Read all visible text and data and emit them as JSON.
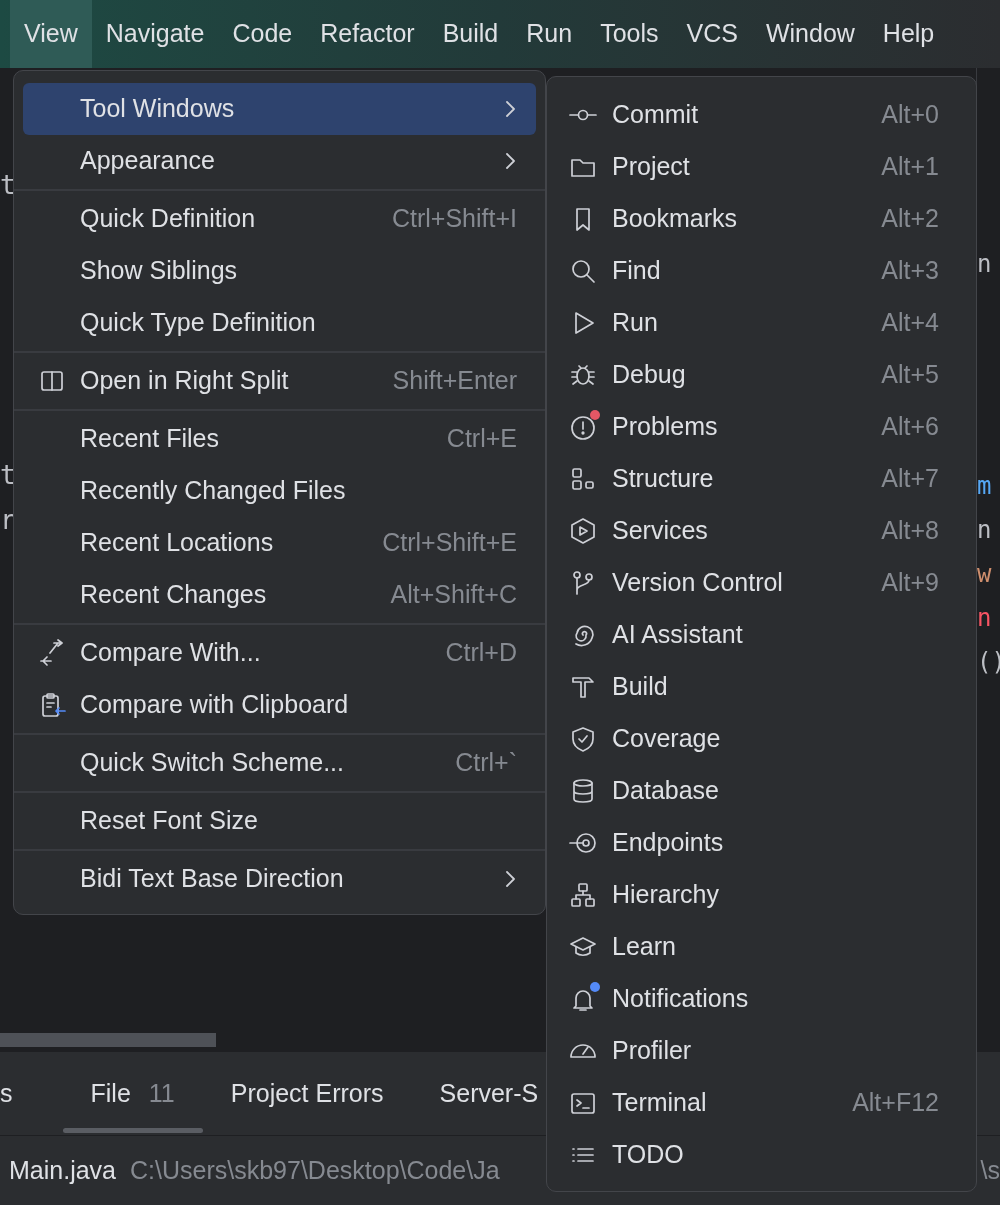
{
  "menu_bar": [
    {
      "label": "View",
      "selected": true
    },
    {
      "label": "Navigate",
      "selected": false
    },
    {
      "label": "Code",
      "selected": false
    },
    {
      "label": "Refactor",
      "selected": false
    },
    {
      "label": "Build",
      "selected": false
    },
    {
      "label": "Run",
      "selected": false
    },
    {
      "label": "Tools",
      "selected": false
    },
    {
      "label": "VCS",
      "selected": false
    },
    {
      "label": "Window",
      "selected": false
    },
    {
      "label": "Help",
      "selected": false
    }
  ],
  "view_menu": [
    {
      "kind": "item",
      "label": "Tool Windows",
      "has_submenu": true,
      "selected": true
    },
    {
      "kind": "item",
      "label": "Appearance",
      "has_submenu": true,
      "selected": false
    },
    {
      "kind": "separator"
    },
    {
      "kind": "item",
      "label": "Quick Definition",
      "shortcut": "Ctrl+Shift+I",
      "has_submenu": false,
      "selected": false
    },
    {
      "kind": "item",
      "label": "Show Siblings",
      "has_submenu": false,
      "selected": false
    },
    {
      "kind": "item",
      "label": "Quick Type Definition",
      "has_submenu": false,
      "selected": false
    },
    {
      "kind": "separator"
    },
    {
      "kind": "item",
      "label": "Open in Right Split",
      "shortcut": "Shift+Enter",
      "has_submenu": false,
      "selected": false
    },
    {
      "kind": "separator"
    },
    {
      "kind": "item",
      "label": "Recent Files",
      "shortcut": "Ctrl+E",
      "has_submenu": false,
      "selected": false
    },
    {
      "kind": "item",
      "label": "Recently Changed Files",
      "has_submenu": false,
      "selected": false
    },
    {
      "kind": "item",
      "label": "Recent Locations",
      "shortcut": "Ctrl+Shift+E",
      "has_submenu": false,
      "selected": false
    },
    {
      "kind": "item",
      "label": "Recent Changes",
      "shortcut": "Alt+Shift+C",
      "has_submenu": false,
      "selected": false
    },
    {
      "kind": "separator"
    },
    {
      "kind": "item",
      "label": "Compare With...",
      "shortcut": "Ctrl+D",
      "has_submenu": false,
      "selected": false
    },
    {
      "kind": "item",
      "label": "Compare with Clipboard",
      "has_submenu": false,
      "selected": false
    },
    {
      "kind": "separator"
    },
    {
      "kind": "item",
      "label": "Quick Switch Scheme...",
      "shortcut": "Ctrl+`",
      "has_submenu": false,
      "selected": false
    },
    {
      "kind": "separator"
    },
    {
      "kind": "item",
      "label": "Reset Font Size",
      "has_submenu": false,
      "selected": false
    },
    {
      "kind": "separator"
    },
    {
      "kind": "item",
      "label": "Bidi Text Base Direction",
      "has_submenu": true,
      "selected": false
    }
  ],
  "tool_windows": [
    {
      "label": "Commit",
      "shortcut": "Alt+0"
    },
    {
      "label": "Project",
      "shortcut": "Alt+1"
    },
    {
      "label": "Bookmarks",
      "shortcut": "Alt+2"
    },
    {
      "label": "Find",
      "shortcut": "Alt+3"
    },
    {
      "label": "Run",
      "shortcut": "Alt+4"
    },
    {
      "label": "Debug",
      "shortcut": "Alt+5"
    },
    {
      "label": "Problems",
      "shortcut": "Alt+6",
      "color": "#e55765"
    },
    {
      "label": "Structure",
      "shortcut": "Alt+7"
    },
    {
      "label": "Services",
      "shortcut": "Alt+8"
    },
    {
      "label": "Version Control",
      "shortcut": "Alt+9"
    },
    {
      "label": "AI Assistant"
    },
    {
      "label": "Build"
    },
    {
      "label": "Coverage"
    },
    {
      "label": "Database"
    },
    {
      "label": "Endpoints"
    },
    {
      "label": "Hierarchy"
    },
    {
      "label": "Learn"
    },
    {
      "label": "Notifications",
      "color": "#548af7"
    },
    {
      "label": "Profiler"
    },
    {
      "label": "Terminal",
      "shortcut": "Alt+F12"
    },
    {
      "label": "TODO"
    }
  ],
  "editor_left_fragments": [
    "t",
    "t",
    "r"
  ],
  "editor_right_fragments": [
    "n",
    "m",
    "n",
    "w",
    "n",
    "()"
  ],
  "tool_tabs": [
    {
      "label": "s",
      "selected": false
    },
    {
      "label": "File",
      "count": "11",
      "selected": true
    },
    {
      "label": "Project Errors",
      "selected": false
    },
    {
      "label": "Server-S",
      "selected": false
    }
  ],
  "status": {
    "file": "Main.java",
    "path": "C:\\Users\\skb97\\Desktop\\Code\\Ja",
    "trailing": "\\s"
  }
}
